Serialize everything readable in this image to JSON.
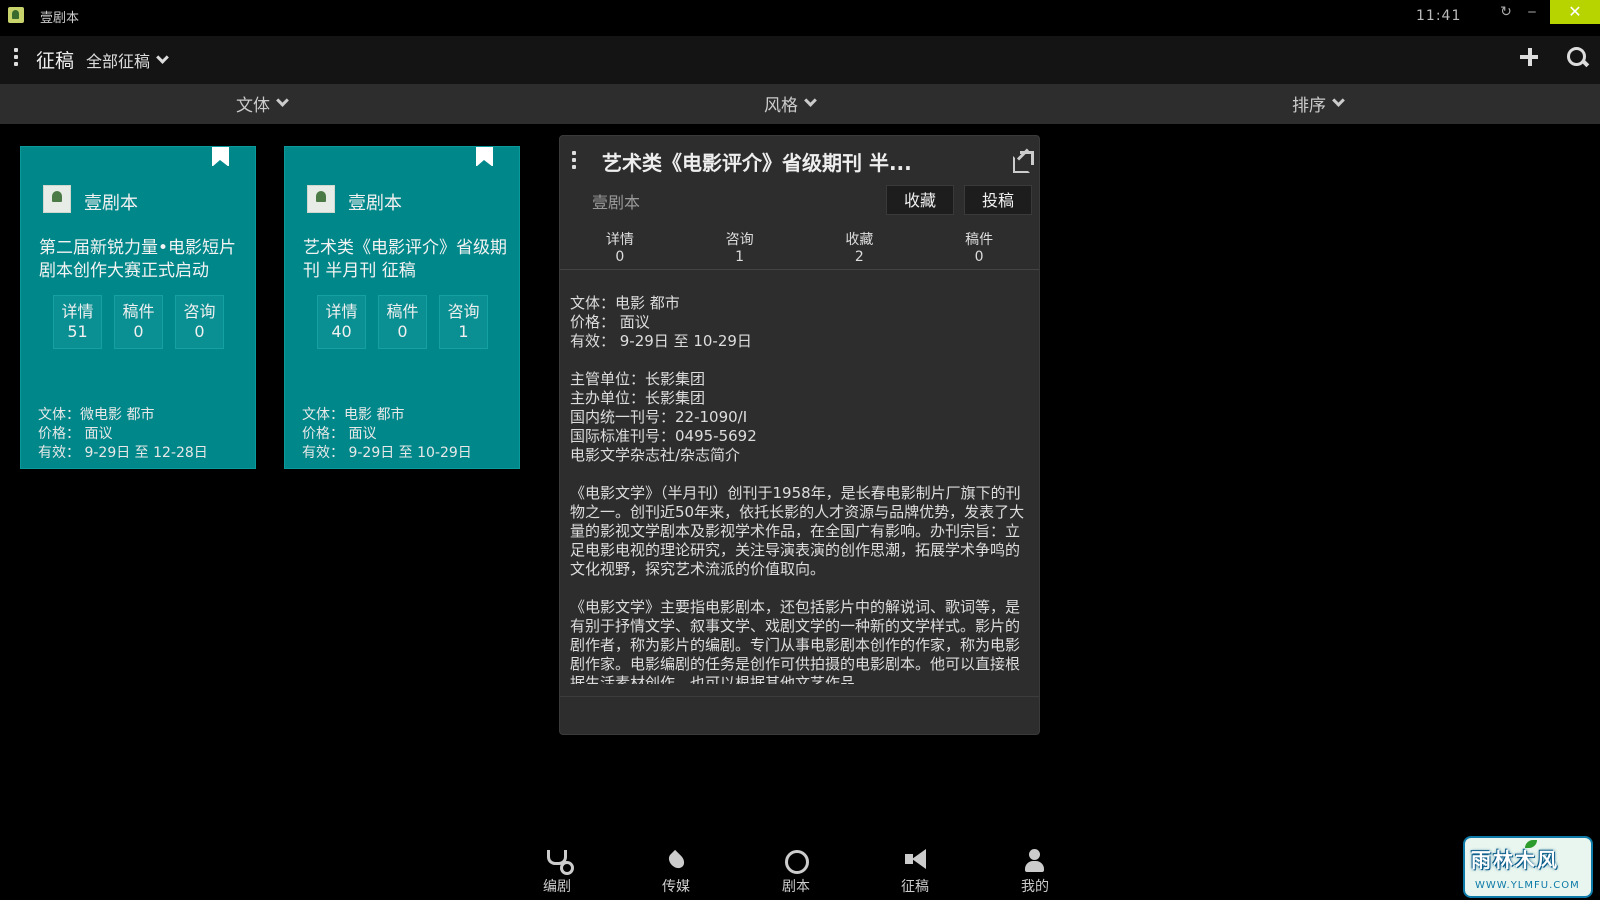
{
  "window": {
    "app_title": "壹剧本",
    "clock": "11:41",
    "refresh_glyph": "↻",
    "minimize_glyph": "‒",
    "close_glyph": "✕"
  },
  "header": {
    "title": "征稿",
    "filter_all": "全部征稿"
  },
  "filters": {
    "genre": "文体",
    "style": "风格",
    "sort": "排序"
  },
  "cards": [
    {
      "org": "壹剧本",
      "title": "第二届新锐力量•电影短片剧本创作大赛正式启动",
      "stats": [
        {
          "label": "详情",
          "value": "51"
        },
        {
          "label": "稿件",
          "value": "0"
        },
        {
          "label": "咨询",
          "value": "0"
        }
      ],
      "genre": "文体：微电影 都市",
      "price": "价格：  面议",
      "valid": "有效：  9-29日 至 12-28日"
    },
    {
      "org": "壹剧本",
      "title": "艺术类《电影评介》省级期刊 半月刊 征稿",
      "stats": [
        {
          "label": "详情",
          "value": "40"
        },
        {
          "label": "稿件",
          "value": "0"
        },
        {
          "label": "咨询",
          "value": "1"
        }
      ],
      "genre": "文体：电影 都市",
      "price": "价格：  面议",
      "valid": "有效：  9-29日 至 10-29日"
    }
  ],
  "detail": {
    "title": "艺术类《电影评介》省级期刊 半...",
    "org": "壹剧本",
    "favorite_label": "收藏",
    "submit_label": "投稿",
    "stats": [
      {
        "label": "详情",
        "value": "0"
      },
      {
        "label": "咨询",
        "value": "1"
      },
      {
        "label": "收藏",
        "value": "2"
      },
      {
        "label": "稿件",
        "value": "0"
      }
    ],
    "info": {
      "genre": "文体：电影 都市",
      "price": "价格：  面议",
      "valid": "有效：  9-29日 至 10-29日"
    },
    "publisher": {
      "sponsor": "主管单位：长影集团",
      "organizer": "主办单位：长影集团",
      "cn_number": "国内统一刊号：22-1090/I",
      "issn": "国际标准刊号：0495-5692",
      "intro_heading": "电影文学杂志社/杂志简介"
    },
    "paragraph1": "《电影文学》（半月刊）创刊于1958年，是长春电影制片厂旗下的刊物之一。创刊近50年来，依托长影的人才资源与品牌优势，发表了大量的影视文学剧本及影视学术作品，在全国广有影响。办刊宗旨：立足电影电视的理论研究，关注导演表演的创作思潮，拓展学术争鸣的文化视野，探究艺术流派的价值取向。",
    "paragraph2": "《电影文学》主要指电影剧本，还包括影片中的解说词、歌词等，是有别于抒情文学、叙事文学、戏剧文学的一种新的文学样式。影片的剧作者，称为影片的编剧。专门从事电影剧本创作的作家，称为电影剧作家。电影编剧的任务是创作可供拍摄的电影剧本。他可以直接根据生活素材创作，也可以根据其他文艺作品"
  },
  "bottom_nav": [
    {
      "label": "编剧",
      "icon": "stethoscope-icon"
    },
    {
      "label": "传媒",
      "icon": "flame-icon"
    },
    {
      "label": "剧本",
      "icon": "ring-icon"
    },
    {
      "label": "征稿",
      "icon": "megaphone-icon"
    },
    {
      "label": "我的",
      "icon": "person-icon"
    }
  ],
  "watermark": {
    "text": "雨林木风",
    "url": "WWW.YLMFU.COM"
  }
}
